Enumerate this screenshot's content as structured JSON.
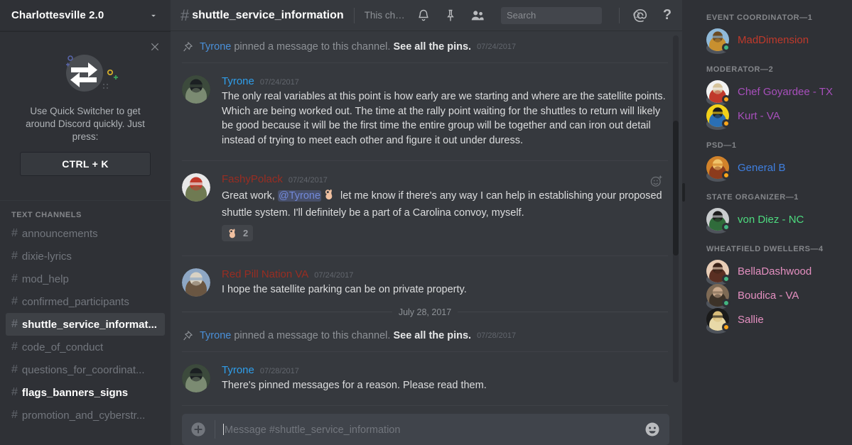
{
  "sidebar": {
    "guild_name": "Charlottesville 2.0",
    "guild_chevron_icon": "chevron-down-icon",
    "promo": {
      "close_icon": "close-icon",
      "art_icon": "quick-switcher-icon",
      "text": "Use Quick Switcher to get around Discord quickly. Just press:",
      "key_label": "CTRL + K"
    },
    "category_label": "TEXT CHANNELS",
    "channels": [
      {
        "name": "announcements",
        "state": "default"
      },
      {
        "name": "dixie-lyrics",
        "state": "default"
      },
      {
        "name": "mod_help",
        "state": "default"
      },
      {
        "name": "confirmed_participants",
        "state": "default"
      },
      {
        "name": "shuttle_service_informat...",
        "state": "active"
      },
      {
        "name": "code_of_conduct",
        "state": "default"
      },
      {
        "name": "questions_for_coordinat...",
        "state": "default"
      },
      {
        "name": "flags_banners_signs",
        "state": "unread"
      },
      {
        "name": "promotion_and_cyberstr...",
        "state": "default"
      }
    ]
  },
  "topbar": {
    "hash": "#",
    "channel_name": "shuttle_service_information",
    "topic": "This channel for is for information on th...",
    "icons": [
      {
        "name": "bell-icon"
      },
      {
        "name": "pin-icon"
      },
      {
        "name": "members-icon"
      }
    ],
    "search": {
      "placeholder": "Search",
      "value": "",
      "icon": "search-icon"
    },
    "mentions_icon": "at-icon",
    "help_icon": "help-icon"
  },
  "messages": [
    {
      "type": "system-pin",
      "icon": "pin-icon",
      "user": "Tyrone",
      "user_color": "#4a90d9",
      "text": " pinned a message to this channel. ",
      "link": "See all the pins.",
      "timestamp": "07/24/2017"
    },
    {
      "type": "message",
      "author": "Tyrone",
      "author_color": "#2f9eea",
      "timestamp": "07/24/2017",
      "avatar": "tyrone-avatar",
      "text": "The only real variables at this point is how early are we starting and where are the satellite points. Which are being worked out. The time at the rally point waiting for the shuttles to return will likely be good because it will be the first time the entire group will be together and can iron out detail instead of trying to meet each other and figure it out under duress."
    },
    {
      "type": "message-mention",
      "author": "FashyPolack",
      "author_color": "#992d22",
      "timestamp": "07/24/2017",
      "avatar": "fashypolack-avatar",
      "text_before": "Great work, ",
      "mention": "@Tyrone",
      "emoji": "ok-hand-emoji",
      "text_after": " let me know if there's any way I can help in establishing your proposed shuttle system. I'll definitely be a part of a Carolina convoy, myself.",
      "reaction": {
        "emoji": "ok-hand-emoji",
        "count": "2"
      },
      "add_reaction_icon": "add-reaction-icon"
    },
    {
      "type": "message",
      "author": "Red Pill Nation VA",
      "author_color": "#992d22",
      "timestamp": "07/24/2017",
      "avatar": "redpill-avatar",
      "text": "I hope the satellite parking can be on private property."
    },
    {
      "type": "date-divider",
      "label": "July 28, 2017"
    },
    {
      "type": "system-pin",
      "icon": "pin-icon",
      "user": "Tyrone",
      "user_color": "#4a90d9",
      "text": " pinned a message to this channel. ",
      "link": "See all the pins.",
      "timestamp": "07/28/2017"
    },
    {
      "type": "message",
      "author": "Tyrone",
      "author_color": "#2f9eea",
      "timestamp": "07/28/2017",
      "avatar": "tyrone-avatar",
      "text": "There's pinned messages for a reason. Please read them."
    }
  ],
  "composer": {
    "plus_icon": "add-attachment-icon",
    "placeholder": "Message #shuttle_service_information",
    "emoji_icon": "emoji-picker-icon"
  },
  "members": [
    {
      "group_label": "EVENT COORDINATOR—1",
      "people": [
        {
          "name": "MadDimension",
          "color": "#c0392b",
          "status": "online",
          "avatar": "maddimension-avatar"
        }
      ]
    },
    {
      "group_label": "MODERATOR—2",
      "people": [
        {
          "name": "Chef Goyardee - TX",
          "color": "#a74fbb",
          "status": "idle",
          "avatar": "chef-avatar"
        },
        {
          "name": "Kurt - VA",
          "color": "#a74fbb",
          "status": "idle",
          "avatar": "kurt-avatar"
        }
      ]
    },
    {
      "group_label": "PSD—1",
      "people": [
        {
          "name": "General B",
          "color": "#3f7fe0",
          "status": "idle",
          "avatar": "generalb-avatar"
        }
      ]
    },
    {
      "group_label": "STATE ORGANIZER—1",
      "people": [
        {
          "name": "von Diez - NC",
          "color": "#4ddb7f",
          "status": "online",
          "avatar": "vondiez-avatar"
        }
      ]
    },
    {
      "group_label": "WHEATFIELD DWELLERS—4",
      "people": [
        {
          "name": "BellaDashwood",
          "color": "#e48fc0",
          "status": "online",
          "avatar": "bella-avatar"
        },
        {
          "name": "Boudica - VA",
          "color": "#e48fc0",
          "status": "online",
          "avatar": "boudica-avatar"
        },
        {
          "name": "Sallie",
          "color": "#e48fc0",
          "status": "idle",
          "avatar": "sallie-avatar"
        }
      ]
    }
  ],
  "colors": {
    "sidebar_bg": "#2f3136",
    "main_bg": "#36393e",
    "link_blue": "#4a90d9",
    "online_green": "#43b581",
    "idle_orange": "#faa61a"
  }
}
